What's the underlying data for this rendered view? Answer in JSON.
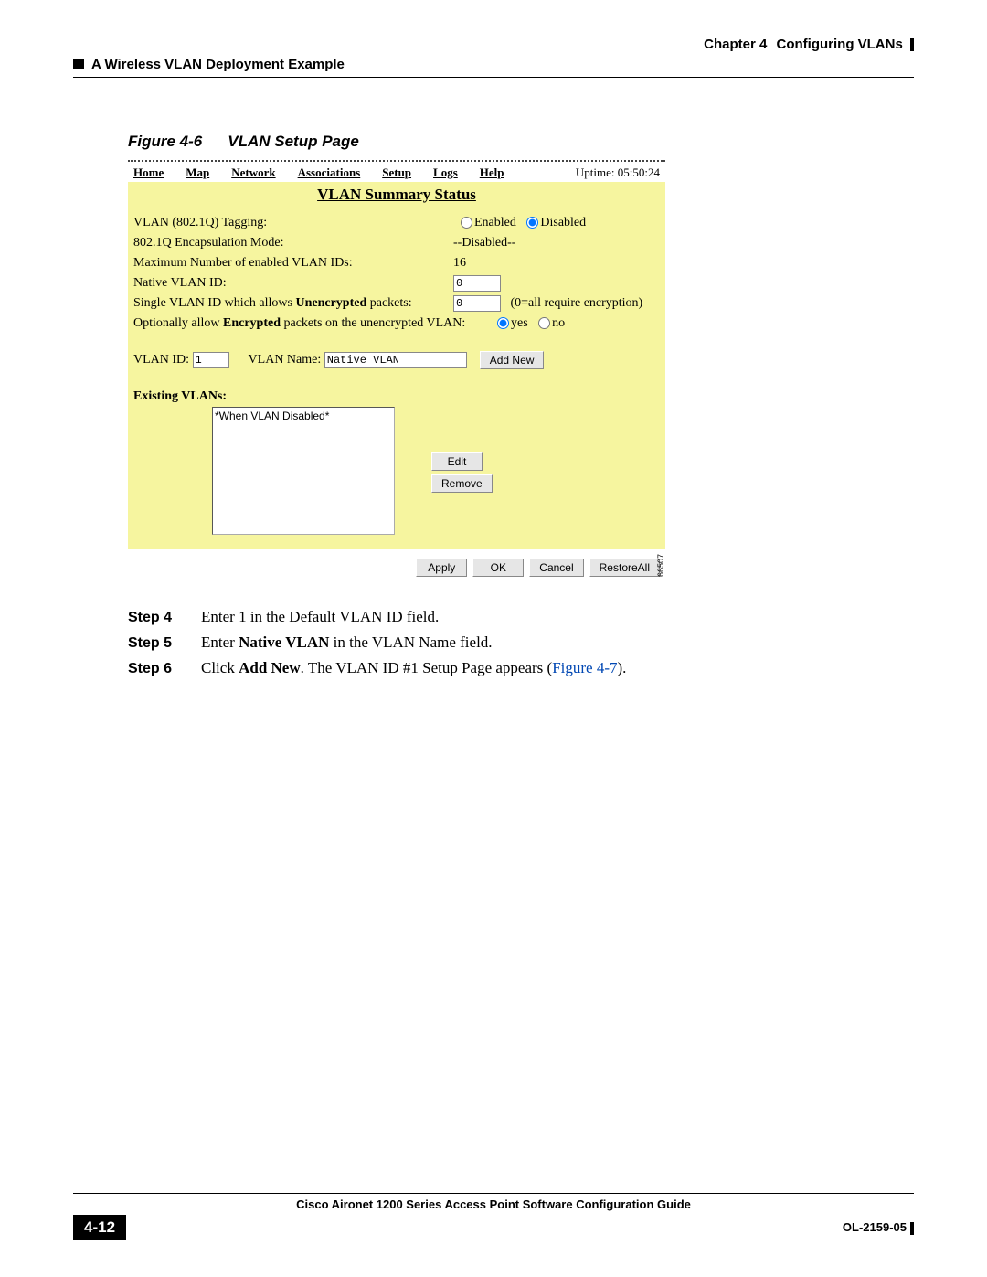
{
  "header": {
    "chapter": "Chapter 4",
    "chapter_title": "Configuring VLANs",
    "section": "A Wireless VLAN Deployment Example"
  },
  "figure": {
    "label": "Figure 4-6",
    "title": "VLAN Setup Page"
  },
  "nav": {
    "items": [
      "Home",
      "Map",
      "Network",
      "Associations",
      "Setup",
      "Logs",
      "Help"
    ],
    "uptime": "Uptime: 05:50:24"
  },
  "panel": {
    "title": "VLAN Summary Status",
    "tagging_label": "VLAN (802.1Q) Tagging:",
    "tagging_enabled": "Enabled",
    "tagging_disabled": "Disabled",
    "encap_label": "802.1Q Encapsulation Mode:",
    "encap_value": "--Disabled--",
    "max_label": "Maximum Number of enabled VLAN IDs:",
    "max_value": "16",
    "native_label": "Native VLAN ID:",
    "native_value": "0",
    "single_label_pre": "Single VLAN ID which allows ",
    "single_label_b": "Unencrypted",
    "single_label_post": " packets:",
    "single_value": "0",
    "single_note": "(0=all require encryption)",
    "opt_label_pre": "Optionally allow ",
    "opt_label_b": "Encrypted",
    "opt_label_post": " packets on the unencrypted VLAN:",
    "opt_yes": "yes",
    "opt_no": "no",
    "vlanid_label": "VLAN ID:",
    "vlanid_value": "1",
    "vlanname_label": "VLAN Name:",
    "vlanname_value": "Native VLAN",
    "addnew": "Add New",
    "existing_label": "Existing VLANs:",
    "existing_item": "*When VLAN Disabled*",
    "edit": "Edit",
    "remove": "Remove",
    "apply": "Apply",
    "ok": "OK",
    "cancel": "Cancel",
    "restore": "RestoreAll",
    "sidecode": "66507"
  },
  "steps": {
    "s4_label": "Step 4",
    "s4_text": "Enter 1 in the Default VLAN ID field.",
    "s5_label": "Step 5",
    "s5_pre": "Enter ",
    "s5_b": "Native VLAN",
    "s5_post": " in the VLAN Name field.",
    "s6_label": "Step 6",
    "s6_pre": "Click ",
    "s6_b": "Add New",
    "s6_mid": ". The VLAN ID #1 Setup Page appears (",
    "s6_link": "Figure 4-7",
    "s6_post": ")."
  },
  "footer": {
    "title": "Cisco Aironet 1200 Series Access Point Software Configuration Guide",
    "page": "4-12",
    "doc": "OL-2159-05"
  }
}
